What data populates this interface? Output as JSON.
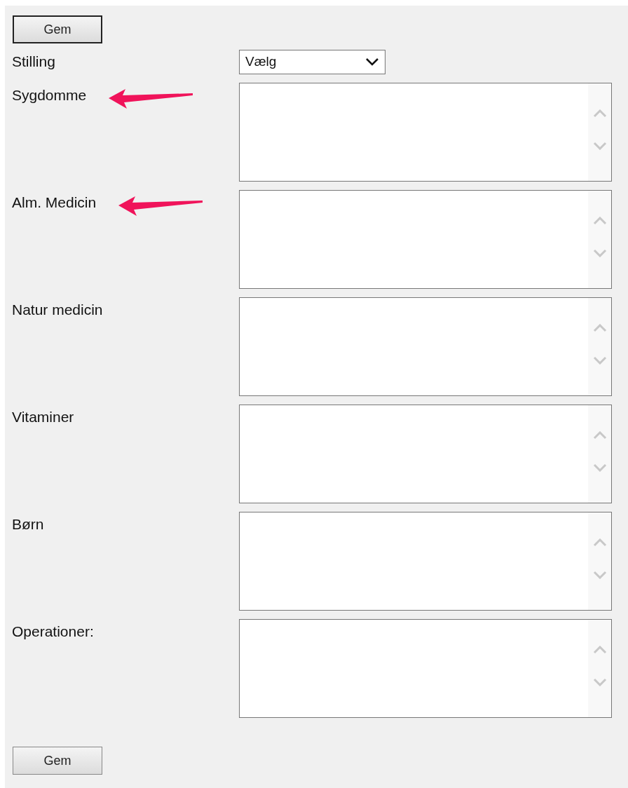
{
  "top_button": {
    "label": "Gem",
    "focused": true
  },
  "position": {
    "label": "Stilling",
    "value": "Vælg"
  },
  "fields": [
    {
      "label": "Sygdomme",
      "annotated": true
    },
    {
      "label": "Alm. Medicin",
      "annotated": true
    },
    {
      "label": "Natur medicin",
      "annotated": false
    },
    {
      "label": "Vitaminer",
      "annotated": false
    },
    {
      "label": "Børn",
      "annotated": false
    },
    {
      "label": "Operationer:",
      "annotated": false
    }
  ],
  "bottom_button": {
    "label": "Gem",
    "focused": false
  }
}
